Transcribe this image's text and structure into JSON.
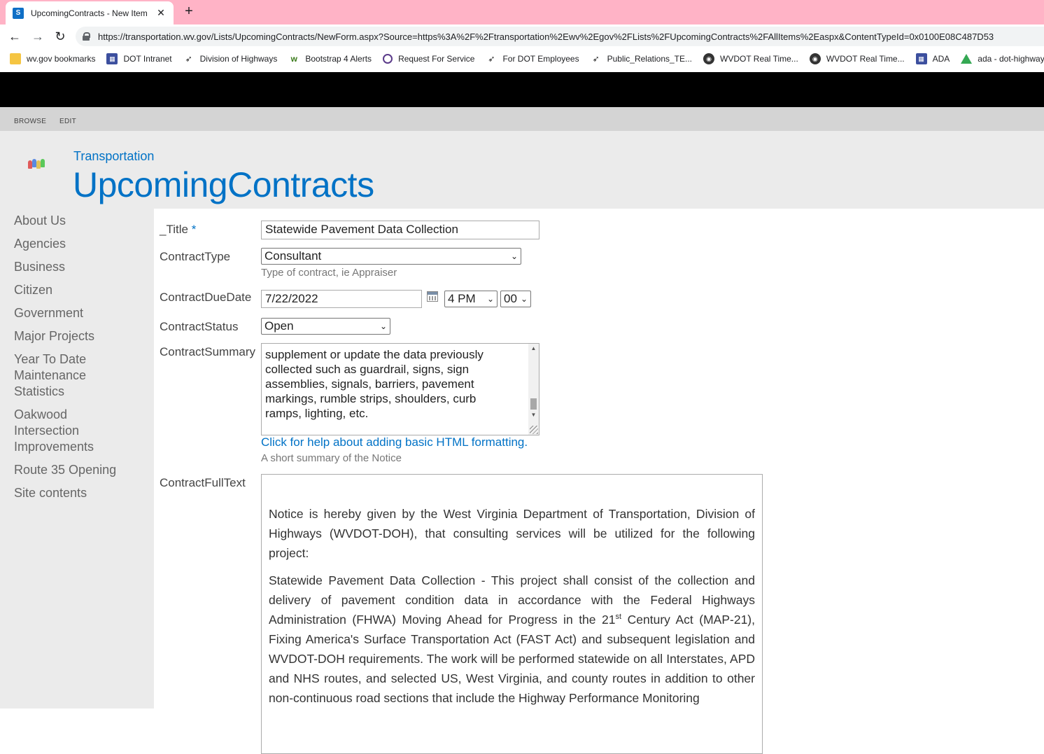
{
  "browser": {
    "tab_title": "UpcomingContracts - New Item",
    "tab_favicon": "S",
    "url": "https://transportation.wv.gov/Lists/UpcomingContracts/NewForm.aspx?Source=https%3A%2F%2Ftransportation%2Ewv%2Egov%2FLists%2FUpcomingContracts%2FAllItems%2Easpx&ContentTypeId=0x0100E08C487D53",
    "bookmarks": [
      {
        "label": "wv.gov bookmarks",
        "icon": "folder-icon"
      },
      {
        "label": "DOT Intranet",
        "icon": "page-icon"
      },
      {
        "label": "Division of Highways",
        "icon": "bird-icon"
      },
      {
        "label": "Bootstrap 4 Alerts",
        "icon": "w-icon"
      },
      {
        "label": "Request For Service",
        "icon": "chat-icon"
      },
      {
        "label": "For DOT Employees",
        "icon": "bird-icon"
      },
      {
        "label": "Public_Relations_TE...",
        "icon": "bird-icon"
      },
      {
        "label": "WVDOT Real Time...",
        "icon": "globe-icon"
      },
      {
        "label": "WVDOT Real Time...",
        "icon": "globe-icon"
      },
      {
        "label": "ADA",
        "icon": "page-icon"
      },
      {
        "label": "ada - dot-highways...",
        "icon": "drive-icon"
      }
    ]
  },
  "ribbon": {
    "browse": "BROWSE",
    "edit": "EDIT"
  },
  "header": {
    "site_name": "Transportation",
    "list_title": "UpcomingContracts"
  },
  "nav": {
    "about": "About Us",
    "agencies": "Agencies",
    "business": "Business",
    "citizen": "Citizen",
    "government": "Government",
    "major_projects": "Major Projects",
    "ytd_1": "Year To Date",
    "ytd_2": "Maintenance",
    "ytd_3": "Statistics",
    "oak_1": "Oakwood",
    "oak_2": "Intersection",
    "oak_3": "Improvements",
    "route35": "Route 35 Opening",
    "site_contents": "Site contents"
  },
  "form": {
    "title_label": "_Title",
    "required_mark": "*",
    "title_value": "Statewide Pavement Data Collection",
    "type_label": "ContractType",
    "type_value": "Consultant",
    "type_hint": "Type of contract, ie Appraiser",
    "due_label": "ContractDueDate",
    "due_date": "7/22/2022",
    "due_hour": "4 PM",
    "due_minute": "00",
    "status_label": "ContractStatus",
    "status_value": "Open",
    "summary_label": "ContractSummary",
    "summary_lines": [
      "supplement or update the data previously",
      "collected such as guardrail, signs, sign",
      "assemblies, signals, barriers, pavement",
      "markings, rumble strips, shoulders, curb",
      "ramps, lighting, etc."
    ],
    "summary_help_link": "Click for help about adding basic HTML formatting.",
    "summary_hint": "A short summary of the Notice",
    "fulltext_label": "ContractFullText",
    "fulltext_p1": "Notice is hereby given by the West Virginia Department of Transportation, Division of Highways (WVDOT-DOH), that consulting services will be utilized for the following project:",
    "fulltext_p2_a": "Statewide Pavement Data Collection - This project shall consist of the collection and delivery of pavement condition data in accordance with the Federal Highways Administration (FHWA) Moving Ahead for Progress in the 21",
    "fulltext_p2_sup": "st",
    "fulltext_p2_b": " Century Act (MAP-21), Fixing America's Surface Transportation Act (FAST Act) and subsequent legislation and WVDOT-DOH requirements. The work will be performed statewide on all Interstates, APD and NHS routes, and selected US, West Virginia, and county routes in addition to other non-continuous road sections that include the Highway Performance Monitoring"
  }
}
